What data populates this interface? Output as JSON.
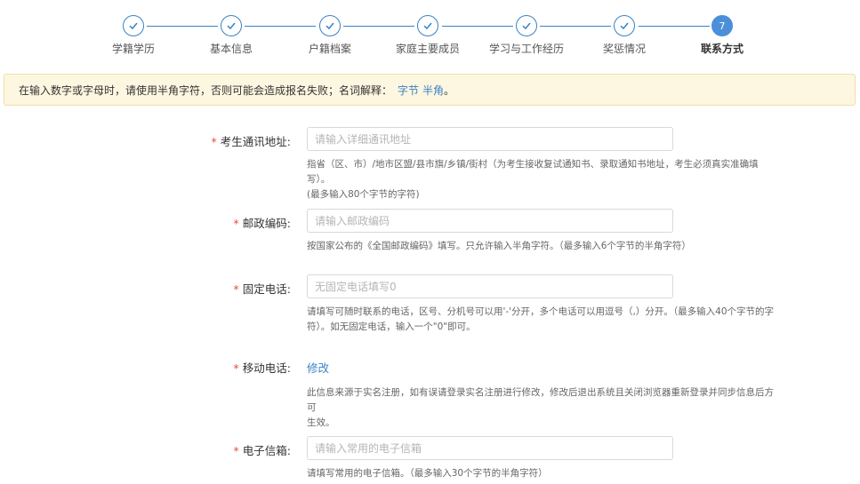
{
  "steps": [
    {
      "label": "学籍学历",
      "status": "done"
    },
    {
      "label": "基本信息",
      "status": "done"
    },
    {
      "label": "户籍档案",
      "status": "done"
    },
    {
      "label": "家庭主要成员",
      "status": "done"
    },
    {
      "label": "学习与工作经历",
      "status": "done"
    },
    {
      "label": "奖惩情况",
      "status": "done"
    },
    {
      "label": "联系方式",
      "status": "active",
      "number": "7"
    }
  ],
  "notice": {
    "text": "在输入数字或字母时，请使用半角字符，否则可能会造成报名失败；名词解释：",
    "link1": "字节",
    "link2": "半角",
    "end": "。"
  },
  "form": {
    "address": {
      "required": "*",
      "label": "考生通讯地址:",
      "placeholder": "请输入详细通讯地址",
      "hint1": "指省（区、市）/地市区盟/县市旗/乡镇/街村（为考生接收复试通知书、录取通知书地址，考生必须真实准确填写）。",
      "hint2": "(最多输入80个字节的字符)"
    },
    "postcode": {
      "required": "*",
      "label": "邮政编码:",
      "placeholder": "请输入邮政编码",
      "hint1": "按国家公布的《全国邮政编码》填写。只允许输入半角字符。（最多输入6个字节的半角字符）"
    },
    "phone": {
      "required": "*",
      "label": "固定电话:",
      "placeholder": "无固定电话填写0",
      "hint1": "请填写可随时联系的电话，区号、分机号可以用'-'分开，多个电话可以用逗号（,）分开。（最多输入40个字节的字",
      "hint2": "符）。如无固定电话，输入一个\"0\"即可。"
    },
    "mobile": {
      "required": "*",
      "label": "移动电话:",
      "edit": "修改",
      "hint1": "此信息来源于实名注册，如有误请登录实名注册进行修改，修改后退出系统且关闭浏览器重新登录并同步信息后方可",
      "hint2": "生效。"
    },
    "email": {
      "required": "*",
      "label": "电子信箱:",
      "placeholder": "请输入常用的电子信箱",
      "hint1": "请填写常用的电子信箱。（最多输入30个字节的半角字符）"
    }
  },
  "colors": {
    "accent": "#3a82c4",
    "required": "#e74c3c",
    "notice_bg": "#fdf6e0"
  }
}
